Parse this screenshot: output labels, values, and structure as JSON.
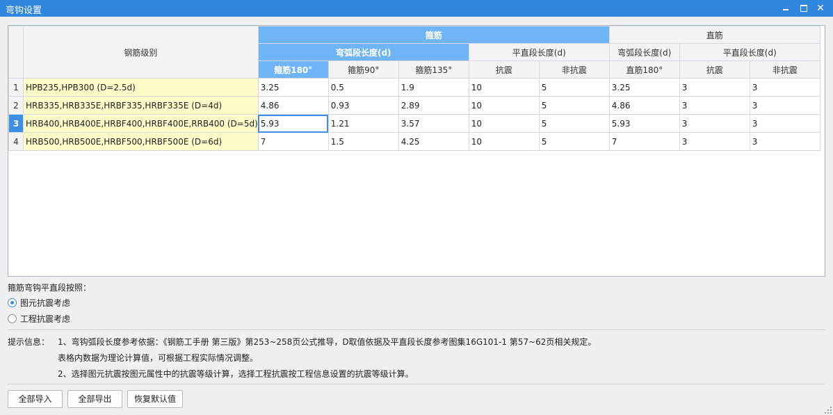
{
  "window": {
    "title": "弯钩设置",
    "close_glyph": "✕"
  },
  "grid": {
    "header": {
      "grade": "钢筋级别",
      "stirrup": "箍筋",
      "straight": "直筋",
      "stirrup_arc": "弯弧段长度(d)",
      "stirrup_flat": "平直段长度(d)",
      "straight_arc": "弯弧段长度(d)",
      "straight_flat": "平直段长度(d)",
      "cols": [
        "箍筋180°",
        "箍筋90°",
        "箍筋135°",
        "抗震",
        "非抗震",
        "直筋180°",
        "抗震",
        "非抗震"
      ]
    },
    "rows": [
      {
        "num": "1",
        "grade": "HPB235,HPB300 (D=2.5d)",
        "values": [
          "3.25",
          "0.5",
          "1.9",
          "10",
          "5",
          "3.25",
          "3",
          "3"
        ]
      },
      {
        "num": "2",
        "grade": "HRB335,HRB335E,HRBF335,HRBF335E (D=4d)",
        "values": [
          "4.86",
          "0.93",
          "2.89",
          "10",
          "5",
          "4.86",
          "3",
          "3"
        ]
      },
      {
        "num": "3",
        "grade": "HRB400,HRB400E,HRBF400,HRBF400E,RRB400 (D=5d)",
        "values": [
          "5.93",
          "1.21",
          "3.57",
          "10",
          "5",
          "5.93",
          "3",
          "3"
        ]
      },
      {
        "num": "4",
        "grade": "HRB500,HRB500E,HRBF500,HRBF500E (D=6d)",
        "values": [
          "7",
          "1.5",
          "4.25",
          "10",
          "5",
          "7",
          "3",
          "3"
        ]
      }
    ],
    "active_row": "3"
  },
  "stirrup_option": {
    "label": "箍筋弯钩平直段按照：",
    "options": [
      "图元抗震考虑",
      "工程抗震考虑"
    ],
    "selected": "图元抗震考虑"
  },
  "hint": {
    "label": "提示信息：",
    "lines": [
      "1、弯钩弧段长度参考依据：《钢筋工手册 第三版》第253~258页公式推导，D取值依据及平直段长度参考图集16G101-1 第57~62页相关规定。",
      "表格内数据为理论计算值，可根据工程实际情况调整。",
      "2、选择图元抗震按图元属性中的抗震等级计算，选择工程抗震按工程信息设置的抗震等级计算。"
    ]
  },
  "buttons": {
    "import_all": "全部导入",
    "export_all": "全部导出",
    "restore_default": "恢复默认值"
  }
}
